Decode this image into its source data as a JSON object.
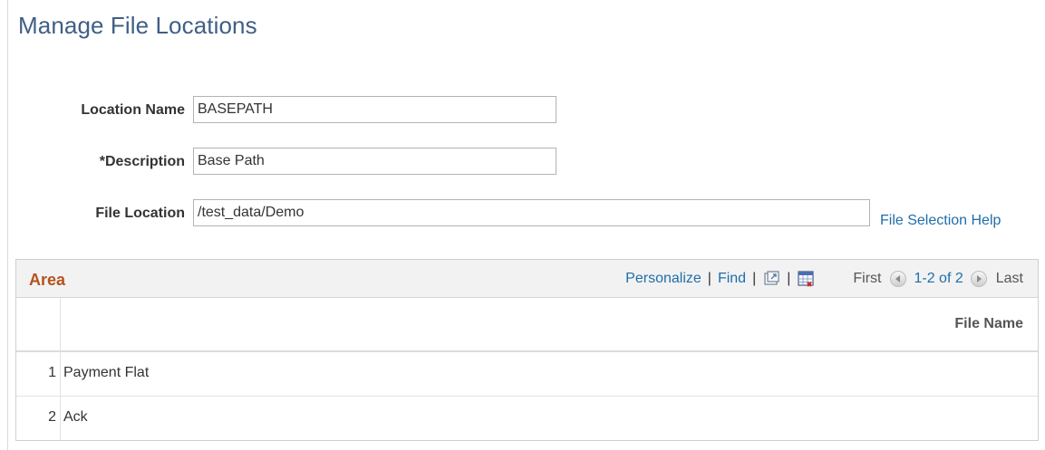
{
  "page": {
    "title": "Manage File Locations"
  },
  "form": {
    "location_name": {
      "label": "Location Name",
      "value": "BASEPATH"
    },
    "description": {
      "label": "*Description",
      "value": "Base Path"
    },
    "file_location": {
      "label": "File Location",
      "value": "/test_data/Demo"
    },
    "help_link": "File Selection Help"
  },
  "grid": {
    "title": "Area",
    "nav": {
      "personalize": "Personalize",
      "separator": "|",
      "find": "Find",
      "first": "First",
      "range": "1-2 of 2",
      "last": "Last"
    },
    "column": "File Name",
    "rows": [
      {
        "num": "1",
        "file_name": "Payment Flat"
      },
      {
        "num": "2",
        "file_name": "Ack"
      }
    ]
  }
}
